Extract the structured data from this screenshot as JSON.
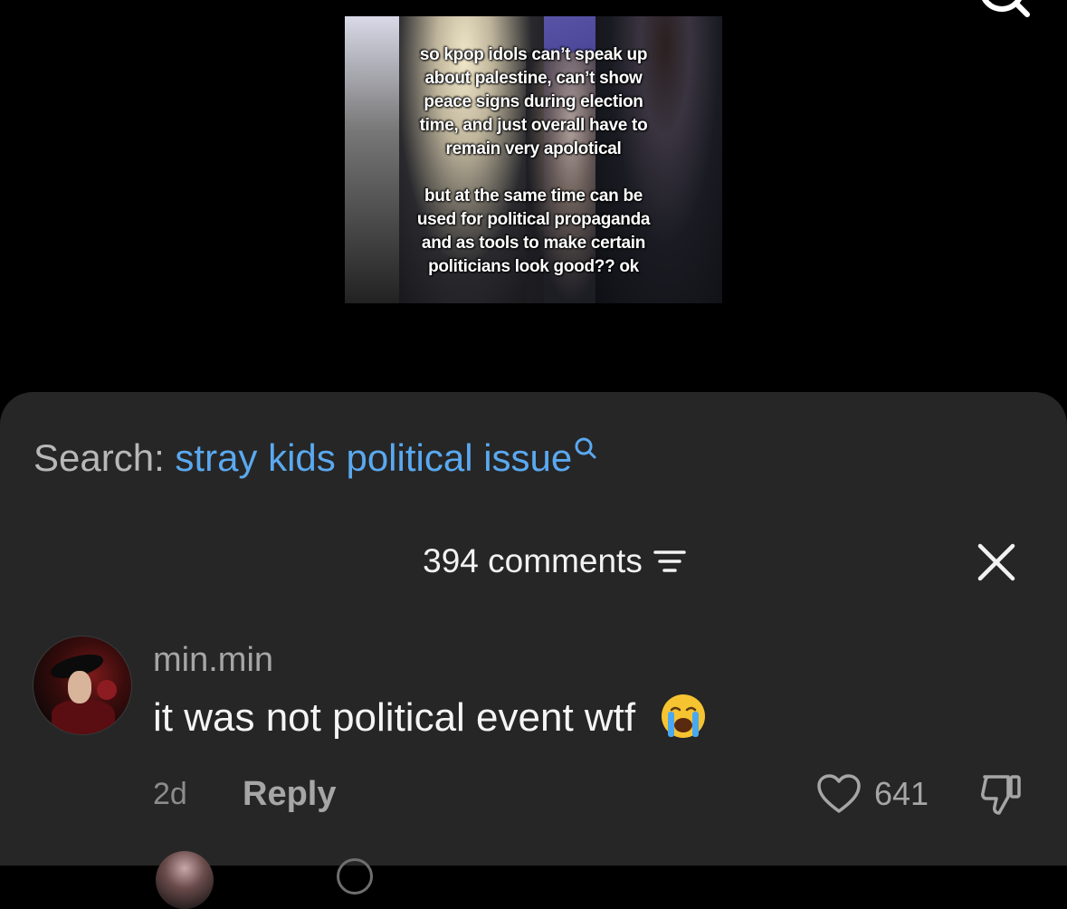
{
  "video": {
    "overlay_text_1": "so kpop idols can’t speak up\nabout palestine, can’t show\npeace signs during election\ntime, and just overall have to\nremain very apolotical",
    "overlay_text_2": "but at the same time can be\nused for political propaganda\nand as tools to make certain\npoliticians look good?? ok"
  },
  "search": {
    "prefix": "Search: ",
    "query": "stray kids political issue",
    "icon": "search-icon"
  },
  "comments": {
    "header": "394 comments",
    "sort_icon": "sort-filter-icon",
    "close_icon": "close-icon",
    "items": [
      {
        "username": "min.min",
        "text": "it was not political event wtf",
        "emoji": "loudly-crying-face",
        "time": "2d",
        "reply_label": "Reply",
        "like_count": "641"
      }
    ]
  },
  "colors": {
    "sheet_bg": "#262626",
    "search_query": "#5aa9f0",
    "search_prefix": "#b8b8b8"
  }
}
